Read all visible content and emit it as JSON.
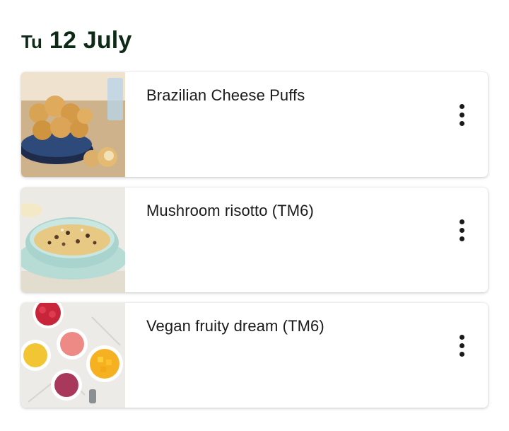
{
  "header": {
    "day_abbrev": "Tu",
    "date": "12 July"
  },
  "recipes": [
    {
      "title": "Brazilian Cheese Puffs",
      "image": "cheese-puffs-photo",
      "menu_icon": "more-vertical-icon"
    },
    {
      "title": "Mushroom risotto (TM6)",
      "image": "mushroom-risotto-photo",
      "menu_icon": "more-vertical-icon"
    },
    {
      "title": "Vegan fruity dream (TM6)",
      "image": "fruity-dream-photo",
      "menu_icon": "more-vertical-icon"
    }
  ],
  "colors": {
    "header_text": "#0e2a16",
    "card_background": "#ffffff",
    "menu_dots": "#1a1a1a"
  }
}
